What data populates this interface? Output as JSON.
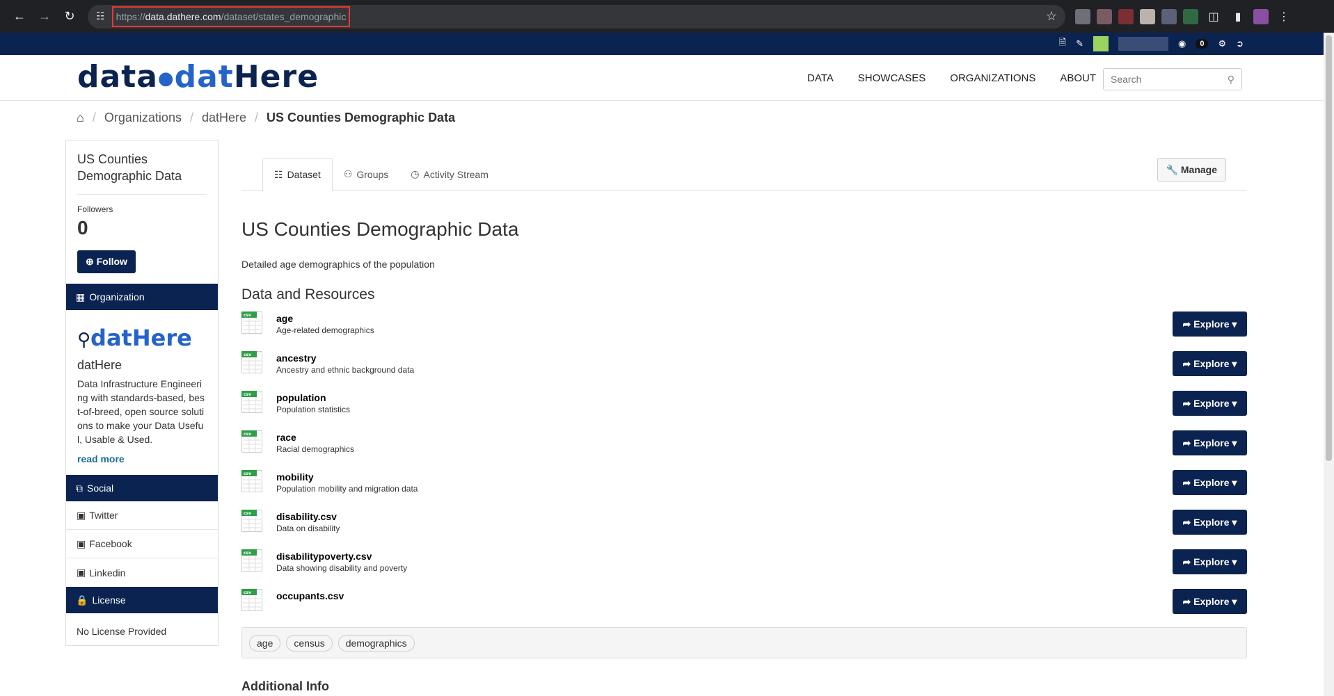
{
  "browser": {
    "url_scheme": "https://",
    "url_host": "data.dathere.com",
    "url_path": "/dataset/states_demographic"
  },
  "account": {
    "notifications": "0"
  },
  "site": {
    "logo_part1": "data",
    "logo_part2": "dat",
    "logo_part3": "Here",
    "nav": [
      "DATA",
      "SHOWCASES",
      "ORGANIZATIONS",
      "ABOUT"
    ],
    "search_placeholder": "Search"
  },
  "breadcrumb": {
    "items": [
      "Organizations",
      "datHere"
    ],
    "current": "US Counties Demographic Data"
  },
  "sidebar": {
    "dataset_title": "US Counties Demographic Data",
    "followers_label": "Followers",
    "followers_count": "0",
    "follow_label": "Follow",
    "organization_heading": "Organization",
    "org_logo_text": "datHere",
    "org_name": "datHere",
    "org_description": "Data Infrastructure Engineering with standards-based, best-of-breed, open source solutions to make your Data Useful, Usable & Used.",
    "read_more": "read more",
    "social_heading": "Social",
    "social": [
      "Twitter",
      "Facebook",
      "Linkedin"
    ],
    "license_heading": "License",
    "license_text": "No License Provided"
  },
  "tabs": [
    "Dataset",
    "Groups",
    "Activity Stream"
  ],
  "manage_label": "Manage",
  "dataset": {
    "title": "US Counties Demographic Data",
    "notes": "Detailed age demographics of the population",
    "resources_heading": "Data and Resources",
    "resources": [
      {
        "name": "age",
        "desc": "Age-related demographics"
      },
      {
        "name": "ancestry",
        "desc": "Ancestry and ethnic background data"
      },
      {
        "name": "population",
        "desc": "Population statistics"
      },
      {
        "name": "race",
        "desc": "Racial demographics"
      },
      {
        "name": "mobility",
        "desc": "Population mobility and migration data"
      },
      {
        "name": "disability.csv",
        "desc": "Data on disability"
      },
      {
        "name": "disabilitypoverty.csv",
        "desc": "Data showing disability and poverty"
      },
      {
        "name": "occupants.csv",
        "desc": ""
      }
    ],
    "explore_label": "Explore",
    "tags": [
      "age",
      "census",
      "demographics"
    ],
    "additional_info": "Additional Info"
  },
  "colors": {
    "brand": "#0b2350",
    "accent": "#2563c9",
    "csv_green": "#2e9e47"
  }
}
